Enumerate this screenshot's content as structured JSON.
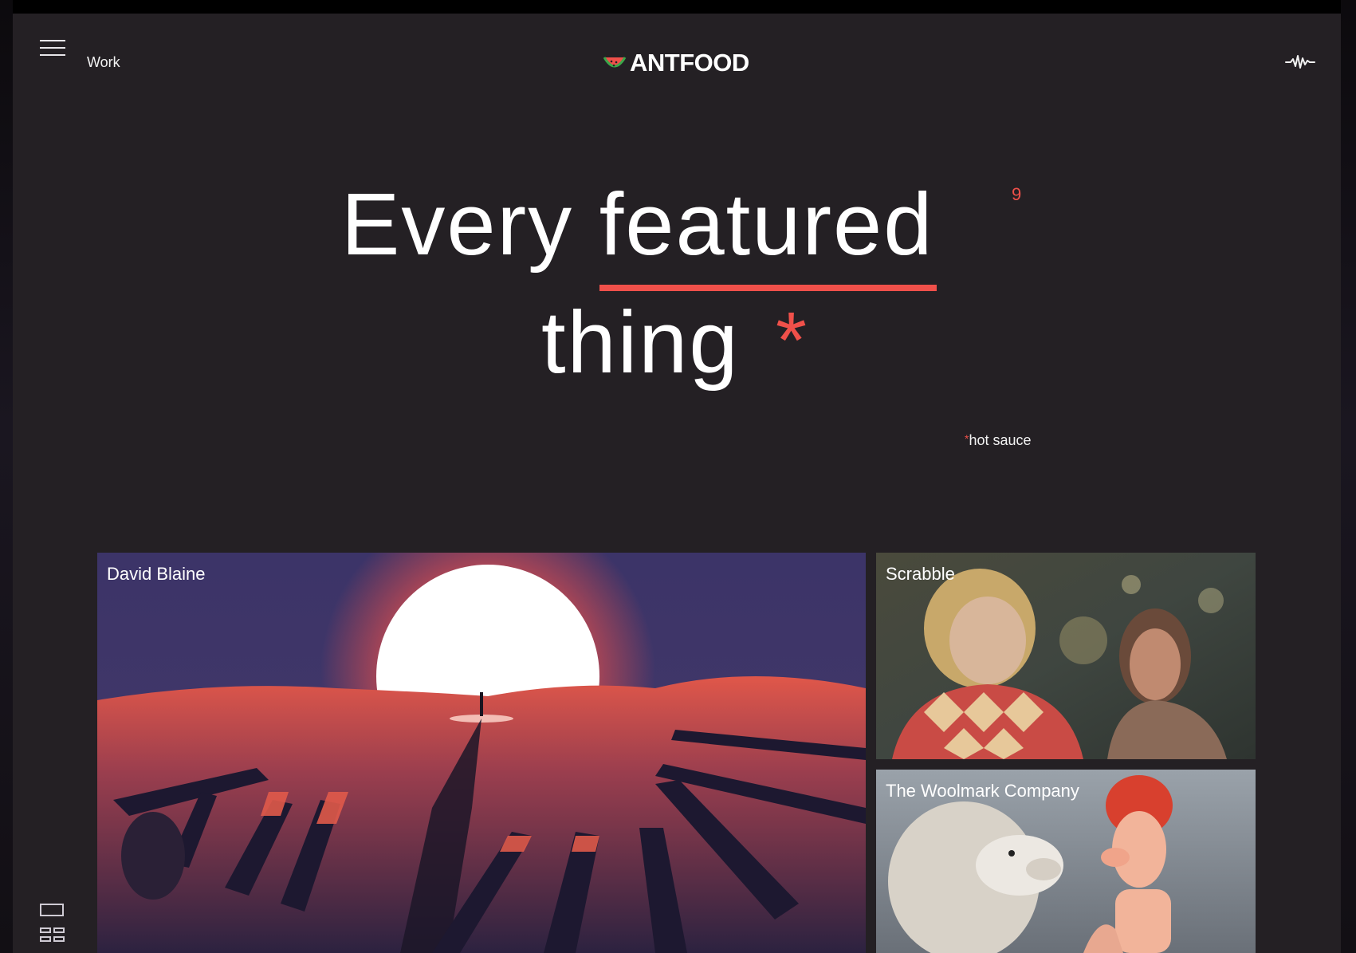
{
  "header": {
    "nav_label": "Work",
    "logo_text": "ANTFOOD"
  },
  "hero": {
    "word1": "Every",
    "word2": "featured",
    "word3": "thing",
    "count": "9",
    "asterisk": "*",
    "footnote_star": "*",
    "footnote_text": "hot sauce"
  },
  "tiles": [
    {
      "label": "David Blaine"
    },
    {
      "label": "Scrabble"
    },
    {
      "label": "The Woolmark Company"
    }
  ],
  "colors": {
    "background": "#242024",
    "accent": "#f0504a",
    "text": "#ffffff"
  },
  "icons": {
    "menu": "hamburger-icon",
    "sound": "soundwave-icon",
    "view_single": "single-view-icon",
    "view_grid": "grid-view-icon"
  }
}
